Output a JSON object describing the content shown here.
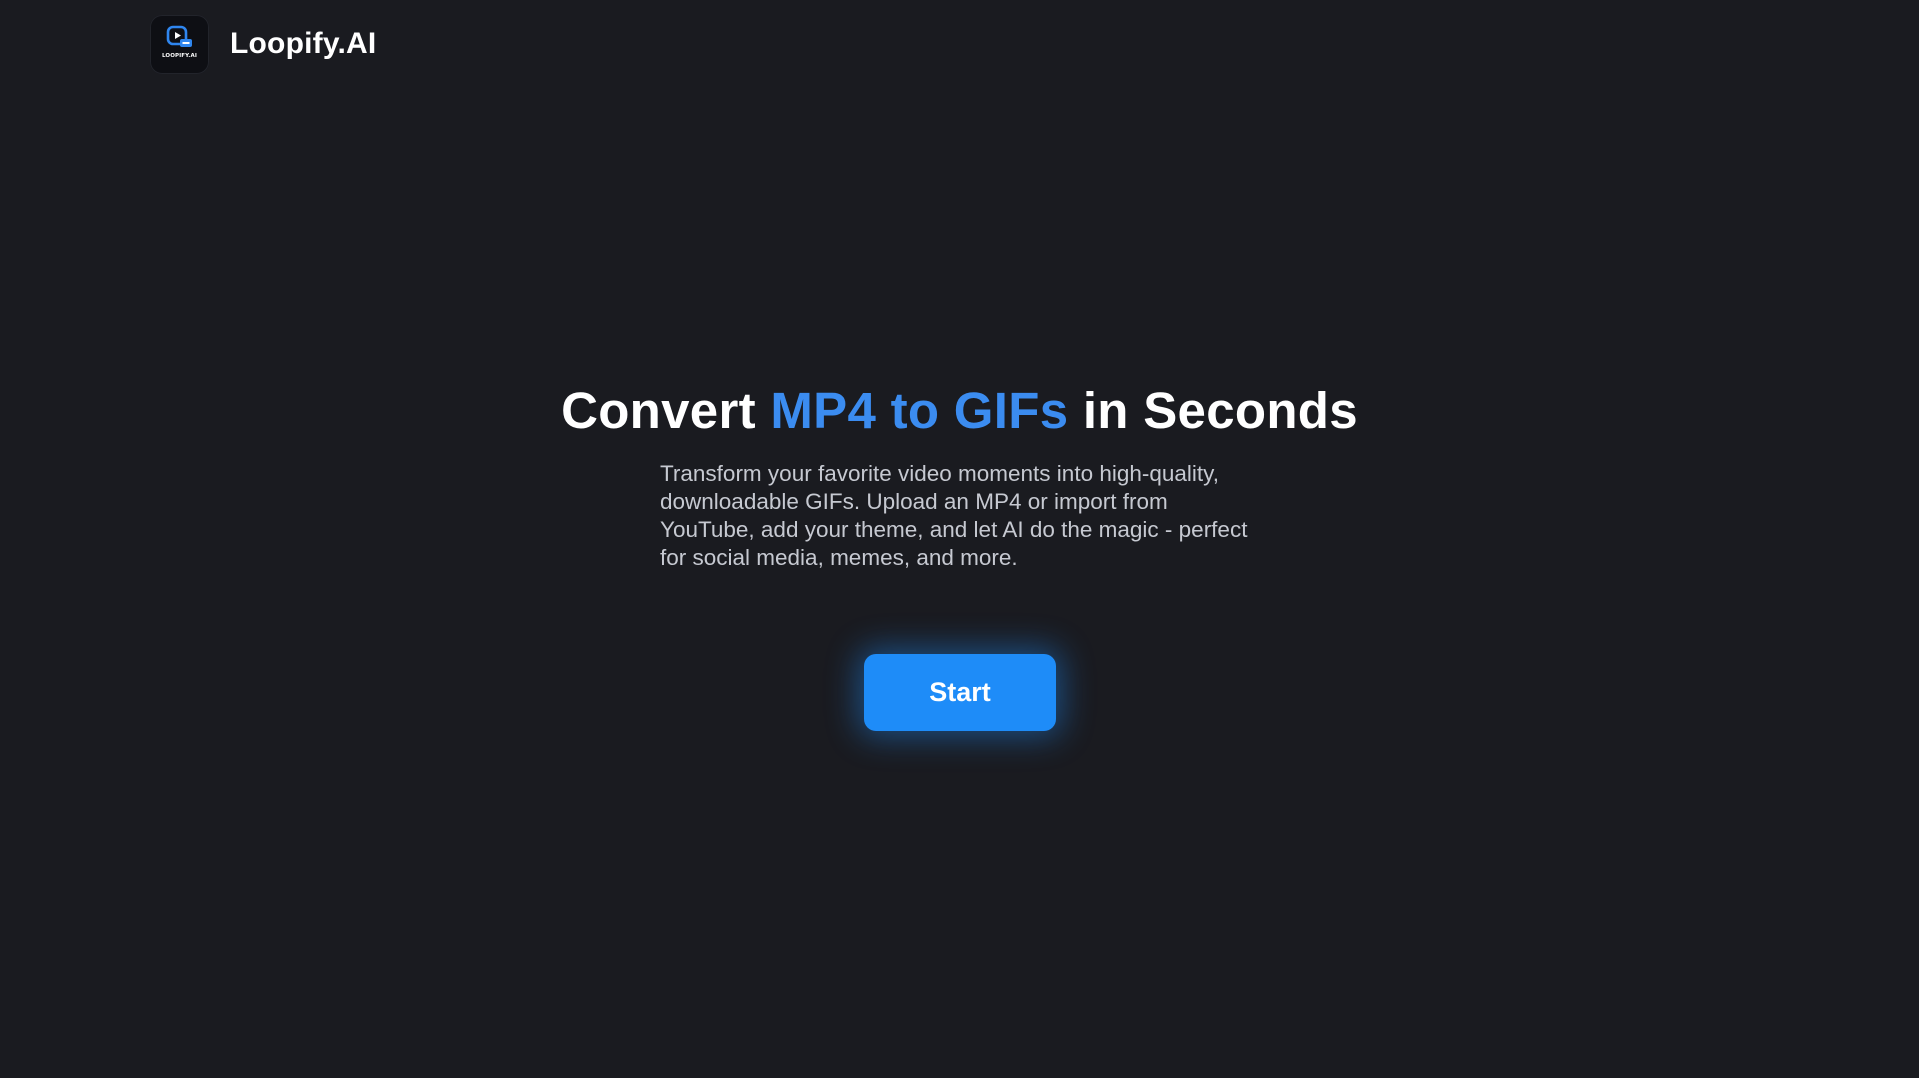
{
  "header": {
    "logo_icon": "play-video-gif-logo-icon",
    "logo_text": "LOOPIFY.AI",
    "brand": "Loopify.AI"
  },
  "hero": {
    "title_before": "Convert ",
    "title_accent": "MP4 to GIFs",
    "title_after": " in Seconds",
    "description": "Transform your favorite video moments into high-quality, downloadable GIFs. Upload an MP4 or import from YouTube, add your theme, and let AI do the magic - perfect for social media, memes, and more.",
    "cta_label": "Start"
  },
  "colors": {
    "background": "#1a1b20",
    "accent": "#3b8cf0",
    "button": "#1e8cf8"
  }
}
